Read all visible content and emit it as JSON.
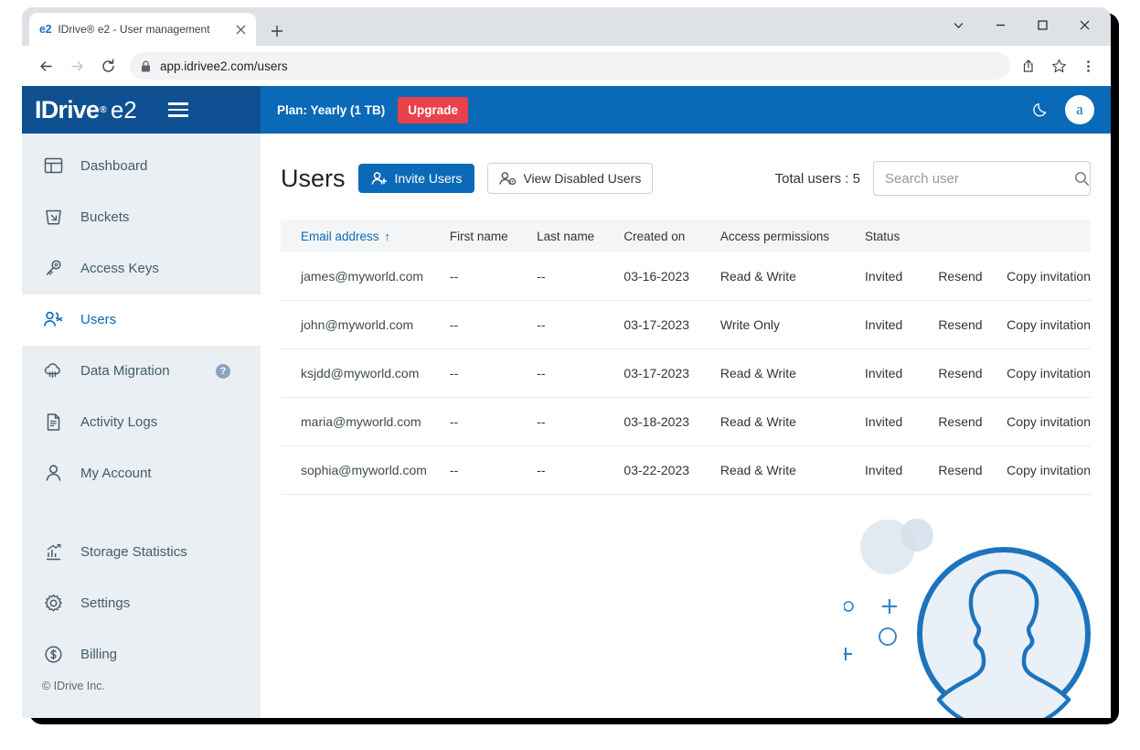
{
  "browser": {
    "tab": {
      "favicon_text": "e2",
      "title": "IDrive® e2 - User management",
      "close_icon": "close-icon"
    },
    "new_tab_icon": "plus-icon",
    "window_controls": [
      "chevron-down-icon",
      "minimize-icon",
      "maximize-icon",
      "close-icon"
    ],
    "nav": {
      "back_icon": "arrow-left-icon",
      "forward_icon": "arrow-right-icon",
      "reload_icon": "reload-icon"
    },
    "omnibox": {
      "lock_icon": "lock-icon",
      "url": "app.idrivee2.com/users"
    },
    "omnibox_actions": [
      "share-icon",
      "bookmark-star-icon",
      "kebab-menu-icon"
    ]
  },
  "header": {
    "brand_name": "IDrive",
    "brand_registered": "®",
    "brand_product": "e2",
    "menu_icon": "hamburger-menu-icon",
    "plan_label": "Plan: Yearly (1 TB)",
    "upgrade_label": "Upgrade",
    "theme_icon": "moon-icon",
    "avatar_initial": "a",
    "colors": {
      "logo_panel": "#0e5091",
      "header_bar": "#0a6ab8",
      "upgrade_red": "#e8414a"
    }
  },
  "sidebar": {
    "items": [
      {
        "label": "Dashboard",
        "icon": "dashboard-icon",
        "active": false
      },
      {
        "label": "Buckets",
        "icon": "bucket-icon",
        "active": false
      },
      {
        "label": "Access Keys",
        "icon": "key-icon",
        "active": false
      },
      {
        "label": "Users",
        "icon": "users-icon",
        "active": true
      },
      {
        "label": "Data Migration",
        "icon": "cloud-migrate-icon",
        "active": false,
        "badge": "?"
      },
      {
        "label": "Activity Logs",
        "icon": "document-icon",
        "active": false
      },
      {
        "label": "My Account",
        "icon": "person-icon",
        "active": false
      }
    ],
    "items_bottom": [
      {
        "label": "Storage Statistics",
        "icon": "bar-chart-icon",
        "active": false
      },
      {
        "label": "Settings",
        "icon": "gear-icon",
        "active": false
      },
      {
        "label": "Billing",
        "icon": "dollar-icon",
        "active": false
      }
    ],
    "footer": "© IDrive Inc."
  },
  "main": {
    "page_title": "Users",
    "invite_users_label": "Invite Users",
    "invite_users_icon": "user-plus-icon",
    "view_disabled_label": "View Disabled Users",
    "view_disabled_icon": "user-disabled-icon",
    "total_users_label": "Total users : 5",
    "search_placeholder": "Search user",
    "search_value": "",
    "search_icon": "search-icon",
    "table": {
      "columns": [
        {
          "label": "Email address",
          "sorted": true,
          "sort_arrow": "↑"
        },
        {
          "label": "First name",
          "sorted": false
        },
        {
          "label": "Last name",
          "sorted": false
        },
        {
          "label": "Created on",
          "sorted": false
        },
        {
          "label": "Access permissions",
          "sorted": false
        },
        {
          "label": "Status",
          "sorted": false
        },
        {
          "label": "",
          "sorted": false
        },
        {
          "label": "",
          "sorted": false
        }
      ],
      "rows": [
        {
          "email": "james@myworld.com",
          "first_name": "--",
          "last_name": "--",
          "created_on": "03-16-2023",
          "access": "Read & Write",
          "status": "Invited",
          "resend": "Resend",
          "copy": "Copy invitation"
        },
        {
          "email": "john@myworld.com",
          "first_name": "--",
          "last_name": "--",
          "created_on": "03-17-2023",
          "access": "Write Only",
          "status": "Invited",
          "resend": "Resend",
          "copy": "Copy invitation"
        },
        {
          "email": "ksjdd@myworld.com",
          "first_name": "--",
          "last_name": "--",
          "created_on": "03-17-2023",
          "access": "Read & Write",
          "status": "Invited",
          "resend": "Resend",
          "copy": "Copy invitation"
        },
        {
          "email": "maria@myworld.com",
          "first_name": "--",
          "last_name": "--",
          "created_on": "03-18-2023",
          "access": "Read & Write",
          "status": "Invited",
          "resend": "Resend",
          "copy": "Copy invitation"
        },
        {
          "email": "sophia@myworld.com",
          "first_name": "--",
          "last_name": "--",
          "created_on": "03-22-2023",
          "access": "Read & Write",
          "status": "Invited",
          "resend": "Resend",
          "copy": "Copy invitation"
        }
      ]
    },
    "illustration_icon": "user-avatar-illustration",
    "colors": {
      "link_blue": "#2fa4e7",
      "accent_blue": "#0a6ab8",
      "sidebar_bg": "#e9eff2"
    }
  }
}
